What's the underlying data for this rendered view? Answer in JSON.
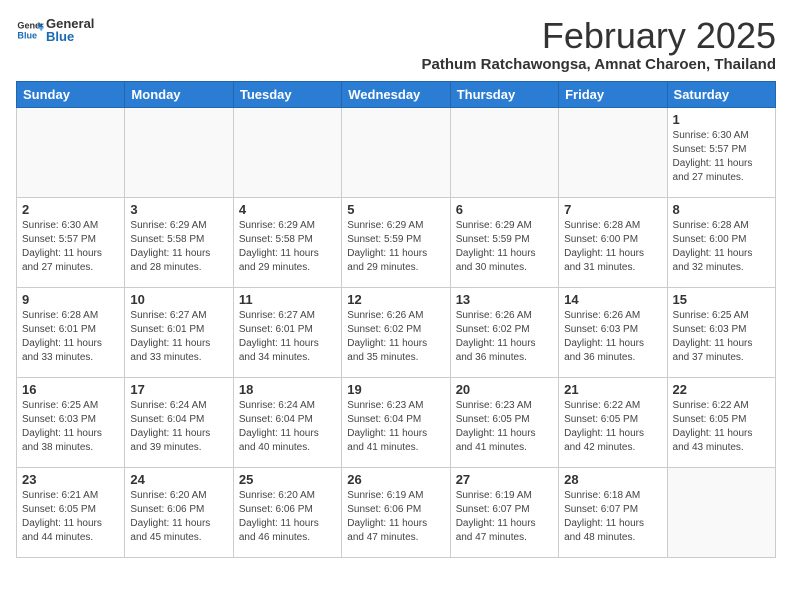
{
  "header": {
    "logo_general": "General",
    "logo_blue": "Blue",
    "title": "February 2025",
    "subtitle": "Pathum Ratchawongsa, Amnat Charoen, Thailand"
  },
  "days_of_week": [
    "Sunday",
    "Monday",
    "Tuesday",
    "Wednesday",
    "Thursday",
    "Friday",
    "Saturday"
  ],
  "weeks": [
    [
      {
        "day": "",
        "info": ""
      },
      {
        "day": "",
        "info": ""
      },
      {
        "day": "",
        "info": ""
      },
      {
        "day": "",
        "info": ""
      },
      {
        "day": "",
        "info": ""
      },
      {
        "day": "",
        "info": ""
      },
      {
        "day": "1",
        "info": "Sunrise: 6:30 AM\nSunset: 5:57 PM\nDaylight: 11 hours and 27 minutes."
      }
    ],
    [
      {
        "day": "2",
        "info": "Sunrise: 6:30 AM\nSunset: 5:57 PM\nDaylight: 11 hours and 27 minutes."
      },
      {
        "day": "3",
        "info": "Sunrise: 6:29 AM\nSunset: 5:58 PM\nDaylight: 11 hours and 28 minutes."
      },
      {
        "day": "4",
        "info": "Sunrise: 6:29 AM\nSunset: 5:58 PM\nDaylight: 11 hours and 29 minutes."
      },
      {
        "day": "5",
        "info": "Sunrise: 6:29 AM\nSunset: 5:59 PM\nDaylight: 11 hours and 29 minutes."
      },
      {
        "day": "6",
        "info": "Sunrise: 6:29 AM\nSunset: 5:59 PM\nDaylight: 11 hours and 30 minutes."
      },
      {
        "day": "7",
        "info": "Sunrise: 6:28 AM\nSunset: 6:00 PM\nDaylight: 11 hours and 31 minutes."
      },
      {
        "day": "8",
        "info": "Sunrise: 6:28 AM\nSunset: 6:00 PM\nDaylight: 11 hours and 32 minutes."
      }
    ],
    [
      {
        "day": "9",
        "info": "Sunrise: 6:28 AM\nSunset: 6:01 PM\nDaylight: 11 hours and 33 minutes."
      },
      {
        "day": "10",
        "info": "Sunrise: 6:27 AM\nSunset: 6:01 PM\nDaylight: 11 hours and 33 minutes."
      },
      {
        "day": "11",
        "info": "Sunrise: 6:27 AM\nSunset: 6:01 PM\nDaylight: 11 hours and 34 minutes."
      },
      {
        "day": "12",
        "info": "Sunrise: 6:26 AM\nSunset: 6:02 PM\nDaylight: 11 hours and 35 minutes."
      },
      {
        "day": "13",
        "info": "Sunrise: 6:26 AM\nSunset: 6:02 PM\nDaylight: 11 hours and 36 minutes."
      },
      {
        "day": "14",
        "info": "Sunrise: 6:26 AM\nSunset: 6:03 PM\nDaylight: 11 hours and 36 minutes."
      },
      {
        "day": "15",
        "info": "Sunrise: 6:25 AM\nSunset: 6:03 PM\nDaylight: 11 hours and 37 minutes."
      }
    ],
    [
      {
        "day": "16",
        "info": "Sunrise: 6:25 AM\nSunset: 6:03 PM\nDaylight: 11 hours and 38 minutes."
      },
      {
        "day": "17",
        "info": "Sunrise: 6:24 AM\nSunset: 6:04 PM\nDaylight: 11 hours and 39 minutes."
      },
      {
        "day": "18",
        "info": "Sunrise: 6:24 AM\nSunset: 6:04 PM\nDaylight: 11 hours and 40 minutes."
      },
      {
        "day": "19",
        "info": "Sunrise: 6:23 AM\nSunset: 6:04 PM\nDaylight: 11 hours and 41 minutes."
      },
      {
        "day": "20",
        "info": "Sunrise: 6:23 AM\nSunset: 6:05 PM\nDaylight: 11 hours and 41 minutes."
      },
      {
        "day": "21",
        "info": "Sunrise: 6:22 AM\nSunset: 6:05 PM\nDaylight: 11 hours and 42 minutes."
      },
      {
        "day": "22",
        "info": "Sunrise: 6:22 AM\nSunset: 6:05 PM\nDaylight: 11 hours and 43 minutes."
      }
    ],
    [
      {
        "day": "23",
        "info": "Sunrise: 6:21 AM\nSunset: 6:05 PM\nDaylight: 11 hours and 44 minutes."
      },
      {
        "day": "24",
        "info": "Sunrise: 6:20 AM\nSunset: 6:06 PM\nDaylight: 11 hours and 45 minutes."
      },
      {
        "day": "25",
        "info": "Sunrise: 6:20 AM\nSunset: 6:06 PM\nDaylight: 11 hours and 46 minutes."
      },
      {
        "day": "26",
        "info": "Sunrise: 6:19 AM\nSunset: 6:06 PM\nDaylight: 11 hours and 47 minutes."
      },
      {
        "day": "27",
        "info": "Sunrise: 6:19 AM\nSunset: 6:07 PM\nDaylight: 11 hours and 47 minutes."
      },
      {
        "day": "28",
        "info": "Sunrise: 6:18 AM\nSunset: 6:07 PM\nDaylight: 11 hours and 48 minutes."
      },
      {
        "day": "",
        "info": ""
      }
    ]
  ]
}
